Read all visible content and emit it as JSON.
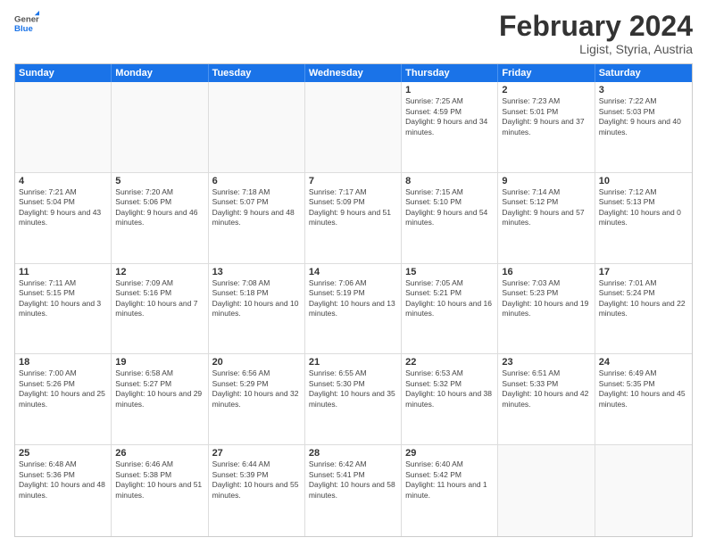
{
  "header": {
    "logo_general": "General",
    "logo_blue": "Blue",
    "title": "February 2024",
    "subtitle": "Ligist, Styria, Austria"
  },
  "weekdays": [
    "Sunday",
    "Monday",
    "Tuesday",
    "Wednesday",
    "Thursday",
    "Friday",
    "Saturday"
  ],
  "weeks": [
    [
      {
        "day": "",
        "sunrise": "",
        "sunset": "",
        "daylight": ""
      },
      {
        "day": "",
        "sunrise": "",
        "sunset": "",
        "daylight": ""
      },
      {
        "day": "",
        "sunrise": "",
        "sunset": "",
        "daylight": ""
      },
      {
        "day": "",
        "sunrise": "",
        "sunset": "",
        "daylight": ""
      },
      {
        "day": "1",
        "sunrise": "Sunrise: 7:25 AM",
        "sunset": "Sunset: 4:59 PM",
        "daylight": "Daylight: 9 hours and 34 minutes."
      },
      {
        "day": "2",
        "sunrise": "Sunrise: 7:23 AM",
        "sunset": "Sunset: 5:01 PM",
        "daylight": "Daylight: 9 hours and 37 minutes."
      },
      {
        "day": "3",
        "sunrise": "Sunrise: 7:22 AM",
        "sunset": "Sunset: 5:03 PM",
        "daylight": "Daylight: 9 hours and 40 minutes."
      }
    ],
    [
      {
        "day": "4",
        "sunrise": "Sunrise: 7:21 AM",
        "sunset": "Sunset: 5:04 PM",
        "daylight": "Daylight: 9 hours and 43 minutes."
      },
      {
        "day": "5",
        "sunrise": "Sunrise: 7:20 AM",
        "sunset": "Sunset: 5:06 PM",
        "daylight": "Daylight: 9 hours and 46 minutes."
      },
      {
        "day": "6",
        "sunrise": "Sunrise: 7:18 AM",
        "sunset": "Sunset: 5:07 PM",
        "daylight": "Daylight: 9 hours and 48 minutes."
      },
      {
        "day": "7",
        "sunrise": "Sunrise: 7:17 AM",
        "sunset": "Sunset: 5:09 PM",
        "daylight": "Daylight: 9 hours and 51 minutes."
      },
      {
        "day": "8",
        "sunrise": "Sunrise: 7:15 AM",
        "sunset": "Sunset: 5:10 PM",
        "daylight": "Daylight: 9 hours and 54 minutes."
      },
      {
        "day": "9",
        "sunrise": "Sunrise: 7:14 AM",
        "sunset": "Sunset: 5:12 PM",
        "daylight": "Daylight: 9 hours and 57 minutes."
      },
      {
        "day": "10",
        "sunrise": "Sunrise: 7:12 AM",
        "sunset": "Sunset: 5:13 PM",
        "daylight": "Daylight: 10 hours and 0 minutes."
      }
    ],
    [
      {
        "day": "11",
        "sunrise": "Sunrise: 7:11 AM",
        "sunset": "Sunset: 5:15 PM",
        "daylight": "Daylight: 10 hours and 3 minutes."
      },
      {
        "day": "12",
        "sunrise": "Sunrise: 7:09 AM",
        "sunset": "Sunset: 5:16 PM",
        "daylight": "Daylight: 10 hours and 7 minutes."
      },
      {
        "day": "13",
        "sunrise": "Sunrise: 7:08 AM",
        "sunset": "Sunset: 5:18 PM",
        "daylight": "Daylight: 10 hours and 10 minutes."
      },
      {
        "day": "14",
        "sunrise": "Sunrise: 7:06 AM",
        "sunset": "Sunset: 5:19 PM",
        "daylight": "Daylight: 10 hours and 13 minutes."
      },
      {
        "day": "15",
        "sunrise": "Sunrise: 7:05 AM",
        "sunset": "Sunset: 5:21 PM",
        "daylight": "Daylight: 10 hours and 16 minutes."
      },
      {
        "day": "16",
        "sunrise": "Sunrise: 7:03 AM",
        "sunset": "Sunset: 5:23 PM",
        "daylight": "Daylight: 10 hours and 19 minutes."
      },
      {
        "day": "17",
        "sunrise": "Sunrise: 7:01 AM",
        "sunset": "Sunset: 5:24 PM",
        "daylight": "Daylight: 10 hours and 22 minutes."
      }
    ],
    [
      {
        "day": "18",
        "sunrise": "Sunrise: 7:00 AM",
        "sunset": "Sunset: 5:26 PM",
        "daylight": "Daylight: 10 hours and 25 minutes."
      },
      {
        "day": "19",
        "sunrise": "Sunrise: 6:58 AM",
        "sunset": "Sunset: 5:27 PM",
        "daylight": "Daylight: 10 hours and 29 minutes."
      },
      {
        "day": "20",
        "sunrise": "Sunrise: 6:56 AM",
        "sunset": "Sunset: 5:29 PM",
        "daylight": "Daylight: 10 hours and 32 minutes."
      },
      {
        "day": "21",
        "sunrise": "Sunrise: 6:55 AM",
        "sunset": "Sunset: 5:30 PM",
        "daylight": "Daylight: 10 hours and 35 minutes."
      },
      {
        "day": "22",
        "sunrise": "Sunrise: 6:53 AM",
        "sunset": "Sunset: 5:32 PM",
        "daylight": "Daylight: 10 hours and 38 minutes."
      },
      {
        "day": "23",
        "sunrise": "Sunrise: 6:51 AM",
        "sunset": "Sunset: 5:33 PM",
        "daylight": "Daylight: 10 hours and 42 minutes."
      },
      {
        "day": "24",
        "sunrise": "Sunrise: 6:49 AM",
        "sunset": "Sunset: 5:35 PM",
        "daylight": "Daylight: 10 hours and 45 minutes."
      }
    ],
    [
      {
        "day": "25",
        "sunrise": "Sunrise: 6:48 AM",
        "sunset": "Sunset: 5:36 PM",
        "daylight": "Daylight: 10 hours and 48 minutes."
      },
      {
        "day": "26",
        "sunrise": "Sunrise: 6:46 AM",
        "sunset": "Sunset: 5:38 PM",
        "daylight": "Daylight: 10 hours and 51 minutes."
      },
      {
        "day": "27",
        "sunrise": "Sunrise: 6:44 AM",
        "sunset": "Sunset: 5:39 PM",
        "daylight": "Daylight: 10 hours and 55 minutes."
      },
      {
        "day": "28",
        "sunrise": "Sunrise: 6:42 AM",
        "sunset": "Sunset: 5:41 PM",
        "daylight": "Daylight: 10 hours and 58 minutes."
      },
      {
        "day": "29",
        "sunrise": "Sunrise: 6:40 AM",
        "sunset": "Sunset: 5:42 PM",
        "daylight": "Daylight: 11 hours and 1 minute."
      },
      {
        "day": "",
        "sunrise": "",
        "sunset": "",
        "daylight": ""
      },
      {
        "day": "",
        "sunrise": "",
        "sunset": "",
        "daylight": ""
      }
    ]
  ]
}
